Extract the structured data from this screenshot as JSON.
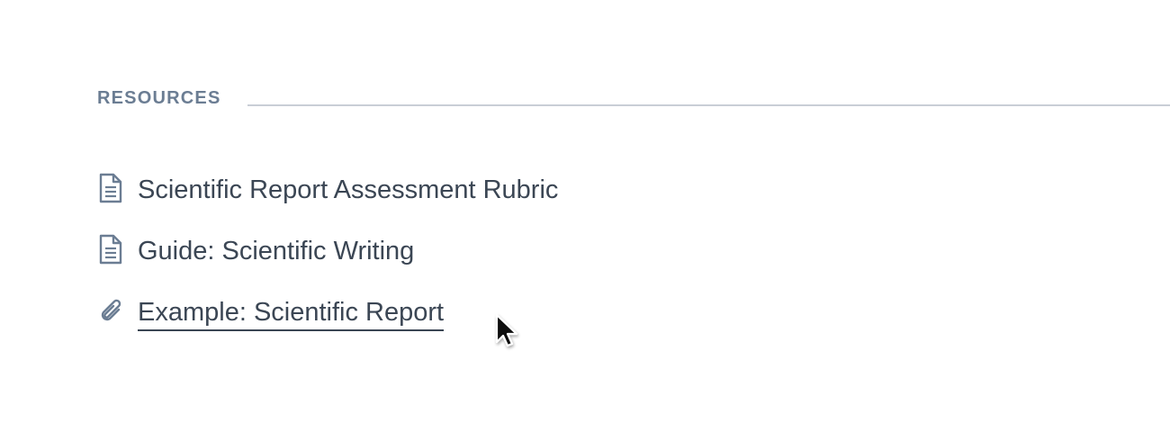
{
  "resources": {
    "title": "RESOURCES",
    "items": [
      {
        "label": "Scientific Report Assessment Rubric",
        "icon": "document-icon",
        "type": "file"
      },
      {
        "label": "Guide: Scientific Writing",
        "icon": "document-icon",
        "type": "file"
      },
      {
        "label": "Example: Scientific Report",
        "icon": "paperclip-icon",
        "type": "link"
      }
    ]
  },
  "colors": {
    "heading": "#6b7d93",
    "text": "#3b4654",
    "icon": "#6b7d93",
    "rule": "#c9ced6"
  }
}
